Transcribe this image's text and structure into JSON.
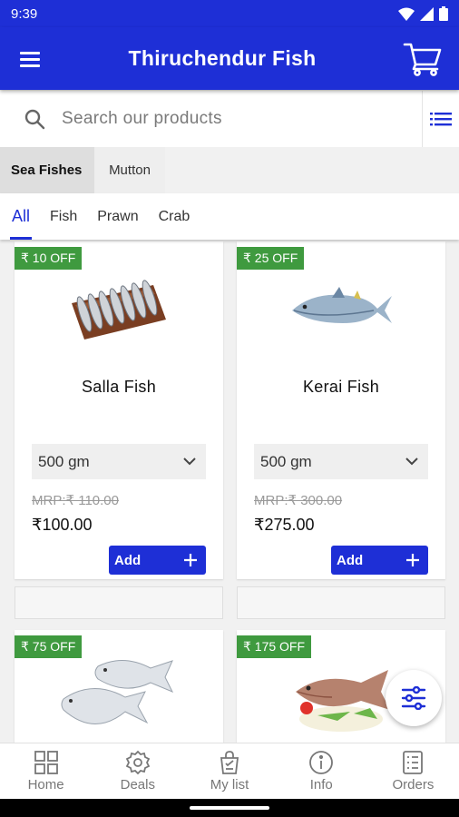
{
  "status_bar": {
    "time": "9:39"
  },
  "header": {
    "title": "Thiruchendur Fish"
  },
  "search": {
    "placeholder": "Search our products"
  },
  "category_tabs": [
    {
      "label": "Sea Fishes",
      "active": true
    },
    {
      "label": "Mutton",
      "active": false
    }
  ],
  "sub_tabs": [
    {
      "label": "All",
      "active": true
    },
    {
      "label": "Fish",
      "active": false
    },
    {
      "label": "Prawn",
      "active": false
    },
    {
      "label": "Crab",
      "active": false
    }
  ],
  "products": [
    {
      "badge": "₹ 10 OFF",
      "name": "Salla Fish",
      "quantity": "500 gm",
      "mrp": "MRP:₹ 110.00",
      "price": "₹100.00",
      "add_label": "Add"
    },
    {
      "badge": "₹ 25 OFF",
      "name": "Kerai Fish",
      "quantity": "500 gm",
      "mrp": "MRP:₹ 300.00",
      "price": "₹275.00",
      "add_label": "Add"
    },
    {
      "badge": "₹ 75 OFF"
    },
    {
      "badge": "₹ 175 OFF"
    }
  ],
  "bottom_nav": [
    {
      "label": "Home",
      "icon": "home-grid-icon"
    },
    {
      "label": "Deals",
      "icon": "deals-badge-icon"
    },
    {
      "label": "My list",
      "icon": "shopping-bag-icon"
    },
    {
      "label": "Info",
      "icon": "info-icon"
    },
    {
      "label": "Orders",
      "icon": "orders-list-icon"
    }
  ],
  "colors": {
    "primary": "#1e2fd6",
    "badge": "#3f9a3f"
  }
}
